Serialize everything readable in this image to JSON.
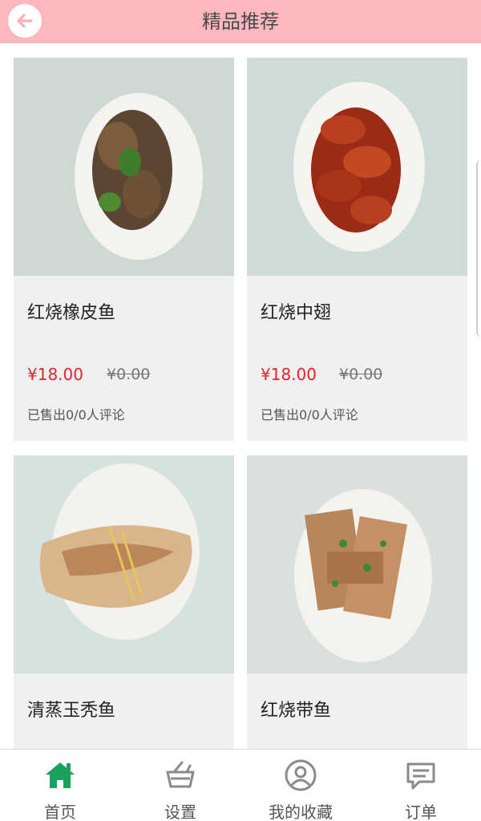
{
  "header": {
    "title": "精品推荐"
  },
  "products": [
    {
      "name": "红烧橡皮鱼",
      "price": "¥18.00",
      "old_price": "¥0.00",
      "meta": "已售出0/0人评论"
    },
    {
      "name": "红烧中翅",
      "price": "¥18.00",
      "old_price": "¥0.00",
      "meta": "已售出0/0人评论"
    },
    {
      "name": "清蒸玉秃鱼"
    },
    {
      "name": "红烧带鱼"
    }
  ],
  "nav": {
    "items": [
      {
        "label": "首页",
        "icon": "home-icon",
        "active": true
      },
      {
        "label": "设置",
        "icon": "basket-icon",
        "active": false
      },
      {
        "label": "我的收藏",
        "icon": "user-circle-icon",
        "active": false
      },
      {
        "label": "订单",
        "icon": "message-icon",
        "active": false
      }
    ]
  },
  "colors": {
    "header_bg": "#fcb8bd",
    "price": "#e2242c",
    "nav_active": "#1aa05f",
    "nav_inactive": "#8a8a8a"
  }
}
